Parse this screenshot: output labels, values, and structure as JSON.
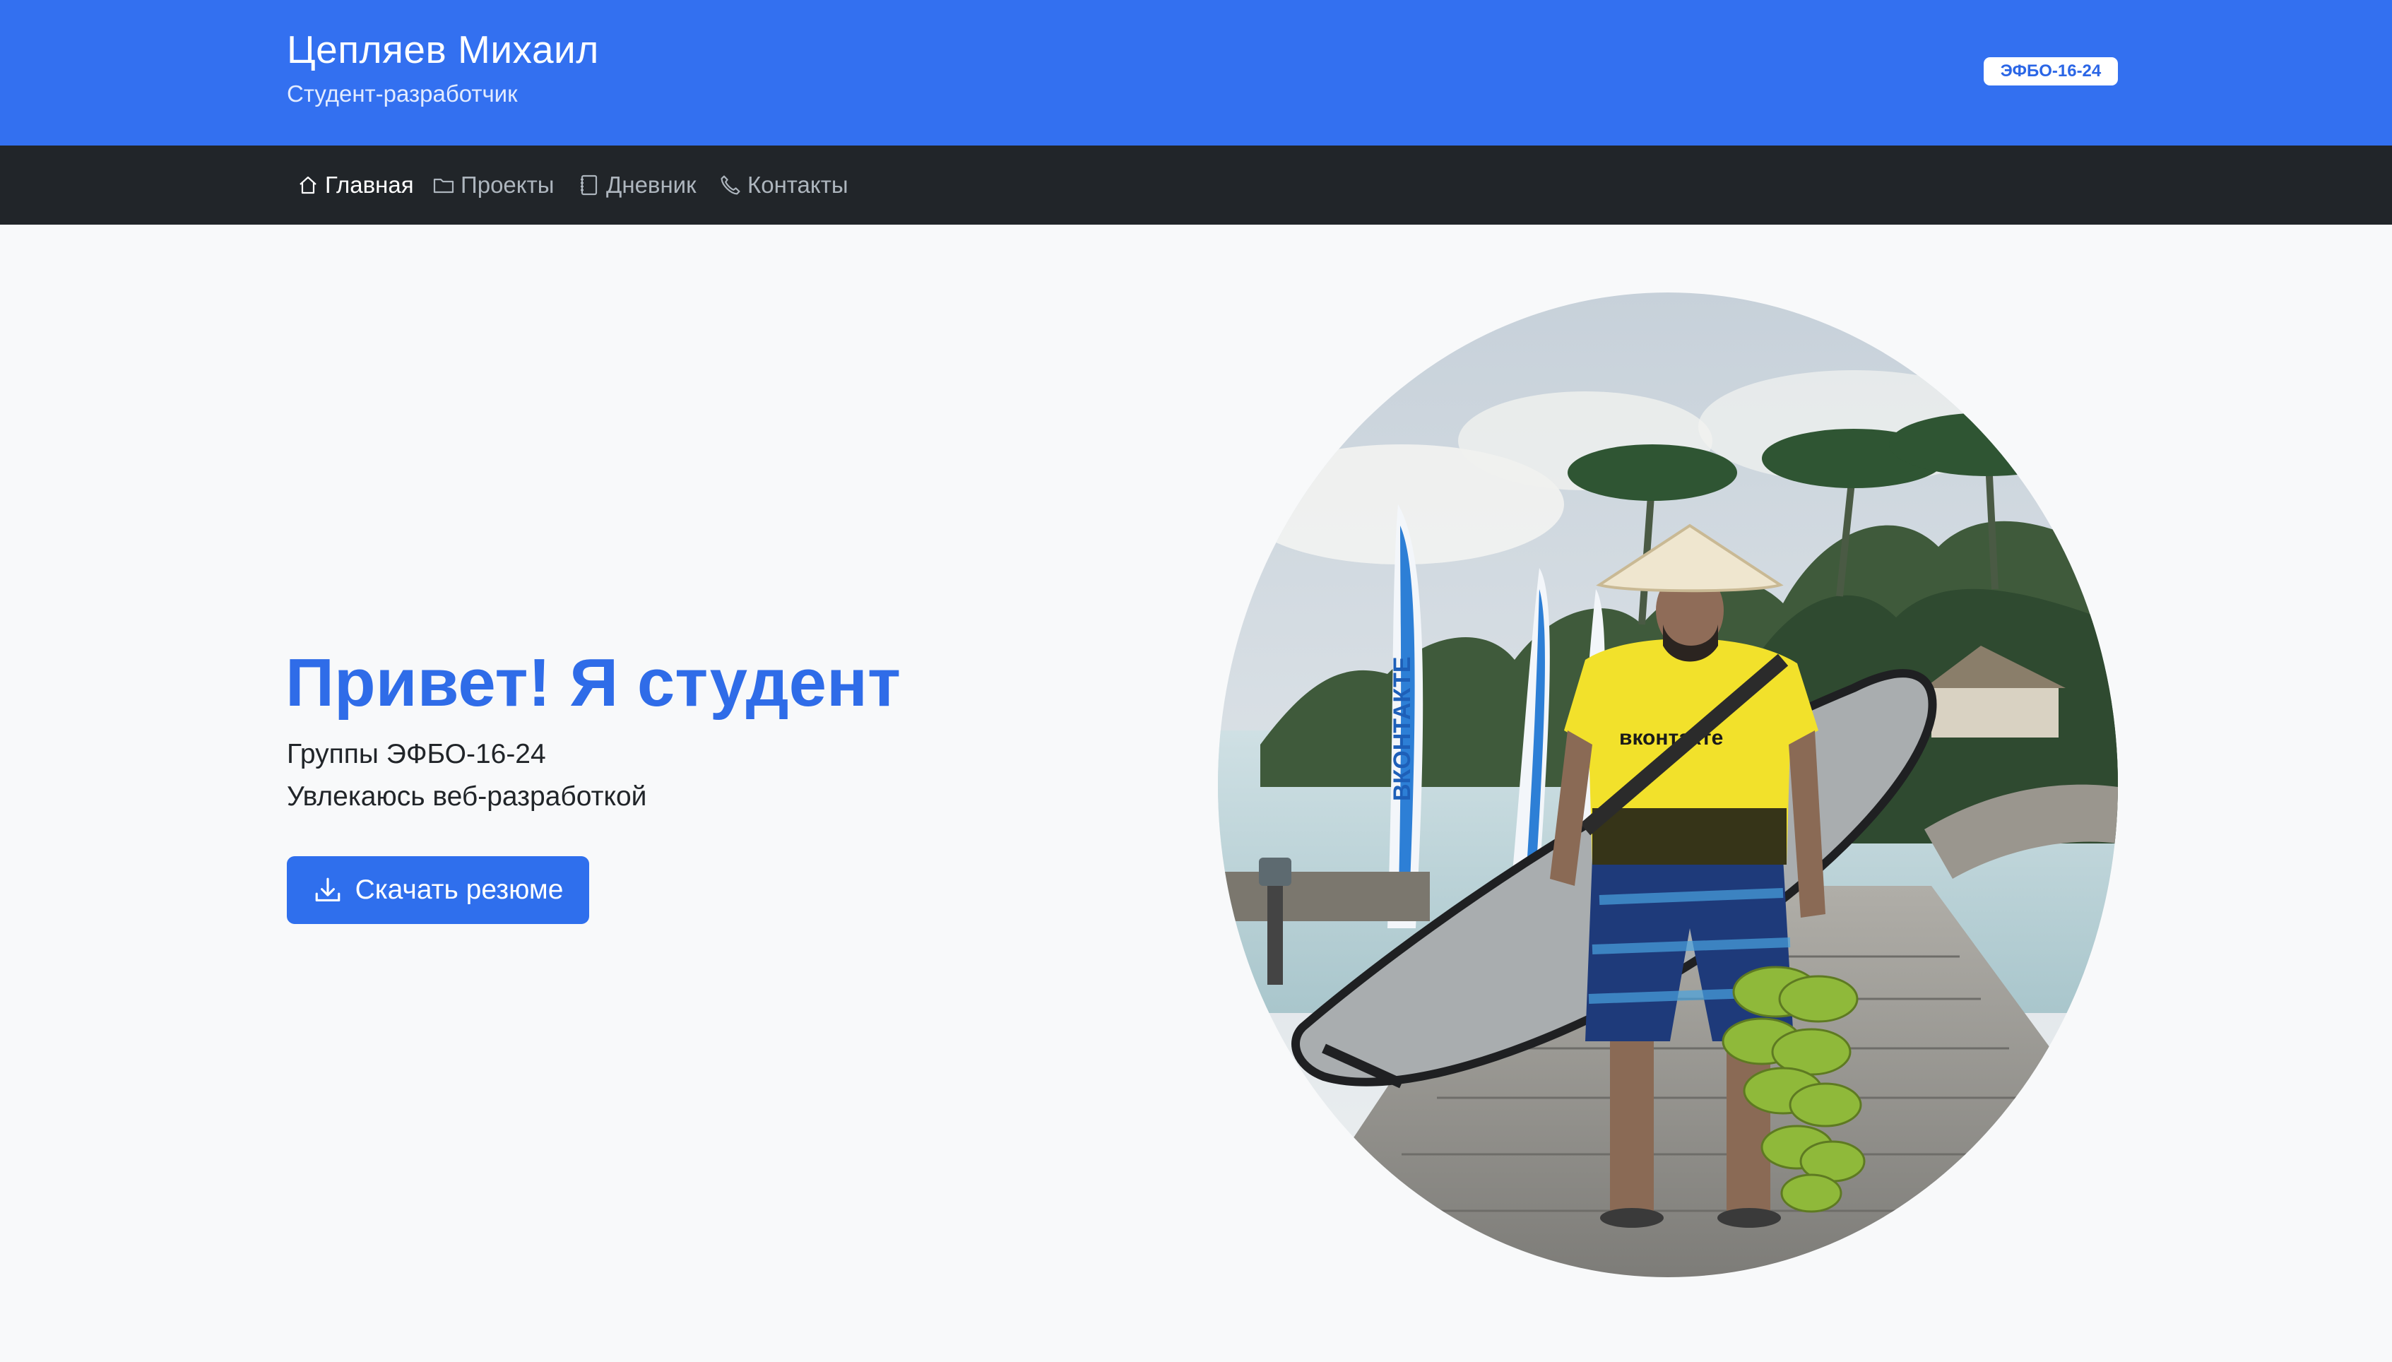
{
  "header": {
    "name": "Цепляев Михаил",
    "subtitle": "Студент-разработчик",
    "badge": "ЭФБО-16-24"
  },
  "nav": {
    "items": [
      {
        "label": "Главная",
        "icon": "home-icon",
        "active": true
      },
      {
        "label": "Проекты",
        "icon": "folder-icon",
        "active": false
      },
      {
        "label": "Дневник",
        "icon": "journal-icon",
        "active": false
      },
      {
        "label": "Контакты",
        "icon": "phone-icon",
        "active": false
      }
    ]
  },
  "hero": {
    "title": "Привет! Я студент",
    "line1": "Группы ЭФБО-16-24",
    "line2": "Увлекаюсь веб-разработкой",
    "button_label": "Скачать резюме",
    "button_icon": "download-icon",
    "photo_flag_text": "ВКОНТАКТЕ",
    "photo_shirt_text": "вконтакте"
  },
  "colors": {
    "header_bg": "#3370f0",
    "nav_bg": "#212529",
    "accent": "#2f6ce8",
    "page_bg": "#f8f9fa"
  }
}
